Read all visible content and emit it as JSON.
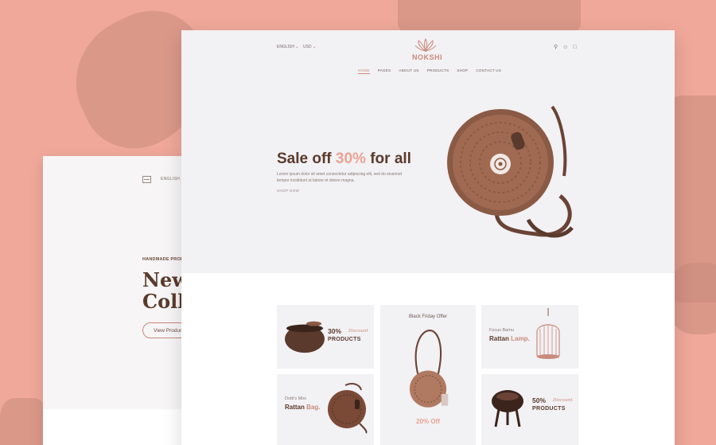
{
  "backdrop_color": "#f0a89a",
  "back_page": {
    "lang": "ENGLISH",
    "eyebrow": "HANDMADE PRODUCT",
    "headline_line1": "New",
    "headline_line2": "Colle",
    "button_label": "View Produc"
  },
  "main_page": {
    "header": {
      "language": "ENGLISH",
      "currency": "USD",
      "logo_text": "NOKSHI",
      "icons": [
        "search-icon",
        "user-icon",
        "cart-icon"
      ]
    },
    "nav": [
      {
        "label": "HOME",
        "active": true
      },
      {
        "label": "PAGES",
        "active": false
      },
      {
        "label": "ABOUT US",
        "active": false
      },
      {
        "label": "PRODUCTS",
        "active": false
      },
      {
        "label": "SHOP",
        "active": false
      },
      {
        "label": "CONTACT US",
        "active": false
      }
    ],
    "hero": {
      "title_prefix": "Sale off ",
      "title_accent": "30%",
      "title_suffix": " for all",
      "description": "Lorem ipsum dolor sit amet consectetur adipiscing elit, sed do eiusmod tempor incididunt ut labore et dolore magna.",
      "link": "SHOP NOW"
    },
    "cards": {
      "card1": {
        "percent": "30%",
        "label": "Discount",
        "sub": "PRODUCTS"
      },
      "card2": {
        "title": "Black Friday Offer",
        "offer": "20% Off"
      },
      "card3": {
        "line1": "Focus Bamu",
        "line2_a": "Rattan ",
        "line2_b": "Lamp."
      },
      "card4": {
        "line1": "Dotti's Mini",
        "line2_a": "Rattan ",
        "line2_b": "Bag."
      },
      "card5": {
        "percent": "50%",
        "label": "Discount",
        "sub": "PRODUCTS"
      }
    }
  },
  "colors": {
    "brand_brown": "#5a3a2c",
    "accent_pink": "#e9a292",
    "hero_bg": "#f2f1f4"
  }
}
